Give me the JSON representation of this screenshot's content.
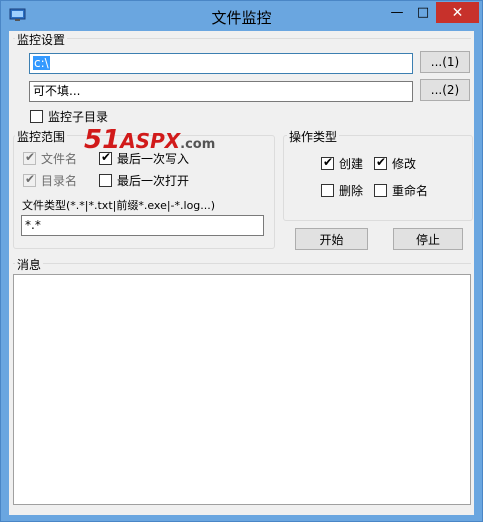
{
  "window": {
    "title": "文件监控"
  },
  "settings": {
    "group_label": "监控设置",
    "path1": "c:\\",
    "path2": "可不填...",
    "browse1": "...(1)",
    "browse2": "...(2)",
    "subdir_label": "监控子目录"
  },
  "scope": {
    "group_label": "监控范围",
    "filename": "文件名",
    "dirname": "目录名",
    "last_write": "最后一次写入",
    "last_open": "最后一次打开",
    "filetype_label": "文件类型(*.*|*.txt|前缀*.exe|-*.log...)",
    "filetype_value": "*.*"
  },
  "ops": {
    "group_label": "操作类型",
    "create": "创建",
    "modify": "修改",
    "delete": "删除",
    "rename": "重命名"
  },
  "actions": {
    "start": "开始",
    "stop": "停止"
  },
  "messages": {
    "group_label": "消息"
  },
  "watermark": {
    "num": "51",
    "brand": "ASPX",
    "tld": ".com"
  }
}
